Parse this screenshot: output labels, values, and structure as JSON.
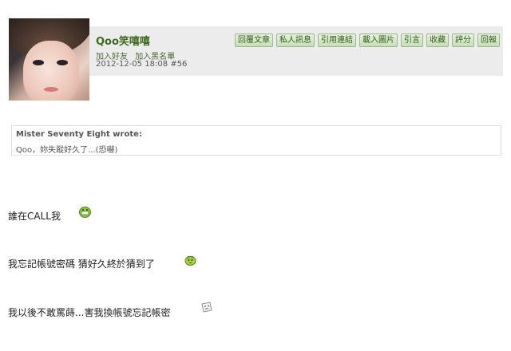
{
  "post": {
    "username": "Qoo笑嘻嘻",
    "add_friend": "加入好友",
    "add_blacklist": "加入黑名單",
    "datetime": "2012-12-05 18:08",
    "post_number": "#56"
  },
  "actions": [
    {
      "label": "回覆文章",
      "name": "reply-post-button"
    },
    {
      "label": "私人訊息",
      "name": "private-message-button"
    },
    {
      "label": "引用連結",
      "name": "quote-link-button"
    },
    {
      "label": "載入圖片",
      "name": "load-images-button"
    },
    {
      "label": "引言",
      "name": "quote-button"
    },
    {
      "label": "收藏",
      "name": "bookmark-button"
    },
    {
      "label": "評分",
      "name": "rate-button"
    },
    {
      "label": "回報",
      "name": "report-button"
    }
  ],
  "quote": {
    "author": "Mister Seventy Eight wrote:",
    "text": "Qoo，妳失蹤好久了...(恐嚇)"
  },
  "body": {
    "line1": "誰在CALL我",
    "line2": "我忘記帳號密碼 猜好久終於猜到了",
    "line3": "我以後不敢罵蒔...害我換帳號忘記帳密"
  },
  "emoticons": {
    "line1": "green-grin-emoticon-icon",
    "line2": "green-blob-emoticon-icon",
    "line3": "paper-face-emoticon-icon"
  }
}
